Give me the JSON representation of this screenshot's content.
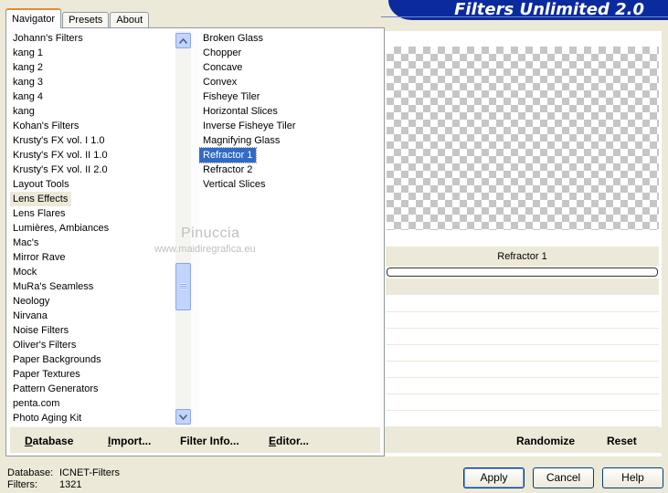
{
  "window": {
    "banner_title": "Filters Unlimited 2.0"
  },
  "tabs": [
    {
      "label": "Navigator",
      "active": true
    },
    {
      "label": "Presets",
      "active": false
    },
    {
      "label": "About",
      "active": false
    }
  ],
  "categories": {
    "items": [
      "Johann's Filters",
      "kang 1",
      "kang 2",
      "kang 3",
      "kang 4",
      "kang",
      "Kohan's Filters",
      "Krusty's FX vol. I 1.0",
      "Krusty's FX vol. II 1.0",
      "Krusty's FX vol. II 2.0",
      "Layout Tools",
      "Lens Effects",
      "Lens Flares",
      "Lumières, Ambiances",
      "Mac's",
      "Mirror Rave",
      "Mock",
      "MuRa's Seamless",
      "Neology",
      "Nirvana",
      "Noise Filters",
      "Oliver's Filters",
      "Paper Backgrounds",
      "Paper Textures",
      "Pattern Generators",
      "penta.com",
      "Photo Aging Kit"
    ],
    "selected": "Lens Effects"
  },
  "filters": {
    "items": [
      "Broken Glass",
      "Chopper",
      "Concave",
      "Convex",
      "Fisheye Tiler",
      "Horizontal Slices",
      "Inverse Fisheye Tiler",
      "Magnifying Glass",
      "Refractor 1",
      "Refractor 2",
      "Vertical Slices"
    ],
    "selected": "Refractor 1"
  },
  "left_buttons": {
    "database": {
      "u": "D",
      "rest": "atabase"
    },
    "import": {
      "u": "I",
      "rest": "mport..."
    },
    "filter_info": {
      "u": "Filter I",
      "rest": "nfo..."
    },
    "editor": {
      "u": "E",
      "rest": "ditor..."
    }
  },
  "preview": {
    "filter_name": "Refractor 1",
    "progress": 0
  },
  "right_buttons": {
    "randomize": "Randomize",
    "reset": "Reset"
  },
  "status": {
    "database_label": "Database:",
    "database_value": "ICNET-Filters",
    "filters_label": "Filters:",
    "filters_value": "1321"
  },
  "dialog_buttons": {
    "apply": "Apply",
    "cancel": "Cancel",
    "help": "Help"
  },
  "watermark": {
    "name": "Pinuccia",
    "url": "www.maidiregrafica.eu"
  },
  "colors": {
    "banner": "#0a2a9e",
    "selection": "#316ac5",
    "dialog_bg": "#ece9d8"
  }
}
